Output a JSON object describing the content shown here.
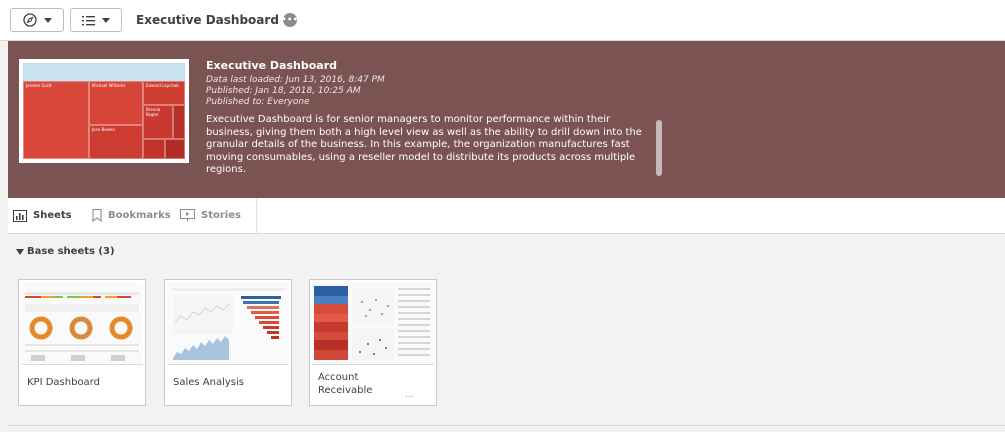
{
  "toolbar": {
    "nav_icon": "compass-icon",
    "list_icon": "list-icon",
    "app_title": "Executive Dashboard",
    "info_icon": "more-icon"
  },
  "app_info": {
    "title": "Executive Dashboard",
    "data_loaded": "Data last loaded: Jun 13, 2016, 8:47 PM",
    "published": "Published: Jan 18, 2018, 10:25 AM",
    "published_to": "Published to: Everyone",
    "description": "Executive Dashboard is for senior managers to monitor performance within their business, giving them both a high level view as well as the ability to drill down into the granular details of the business. In this example, the organization manufactures fast moving consumables, using a reseller model to distribute its products across multiple regions.",
    "thumbnail": {
      "labels": [
        "Jerome Scott",
        "Michael Williams",
        "Edward Laychak",
        "Brenda Kegler",
        "Jose Bowen"
      ]
    }
  },
  "tabs": [
    {
      "label": "Sheets",
      "icon": "sheets-icon",
      "active": true
    },
    {
      "label": "Bookmarks",
      "icon": "bookmark-icon",
      "active": false
    },
    {
      "label": "Stories",
      "icon": "stories-icon",
      "active": false
    }
  ],
  "section": {
    "title": "Base sheets (3)"
  },
  "sheets": [
    {
      "label": "KPI Dashboard"
    },
    {
      "label": "Sales Analysis"
    },
    {
      "label": "Account Receivable",
      "more": "..."
    }
  ],
  "colors": {
    "banner": "#7b5353",
    "treemap_red": "#d9483b",
    "treemap_dark": "#c0342b"
  }
}
